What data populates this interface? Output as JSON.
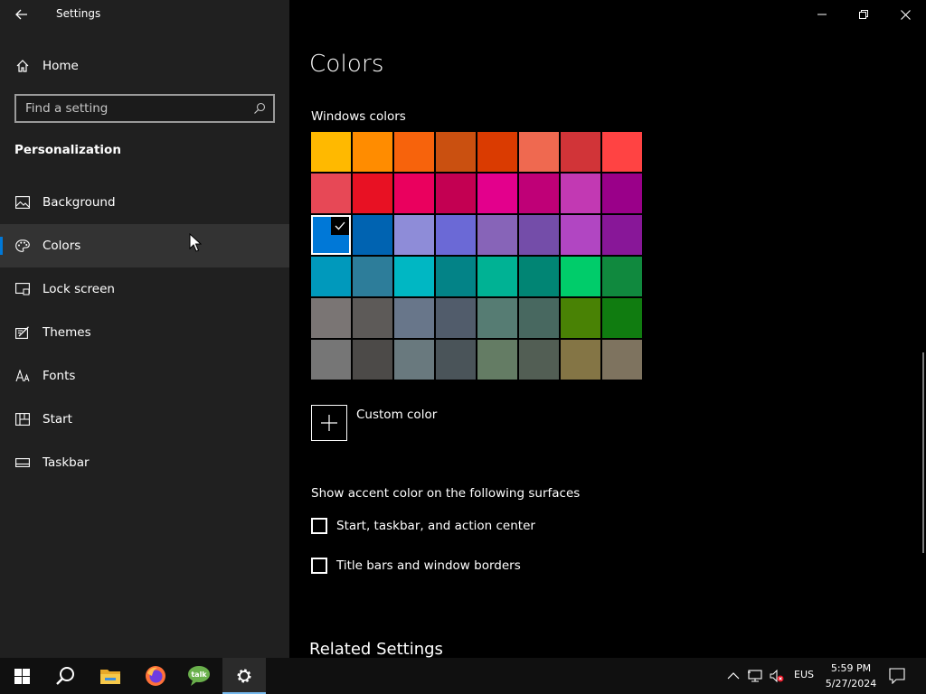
{
  "window": {
    "app_title": "Settings",
    "controls": [
      "minimize-icon",
      "restore-icon",
      "close-icon"
    ]
  },
  "sidebar": {
    "home_label": "Home",
    "search_placeholder": "Find a setting",
    "section_title": "Personalization",
    "items": [
      {
        "label": "Background",
        "icon": "picture-icon"
      },
      {
        "label": "Colors",
        "icon": "palette-icon",
        "selected": true
      },
      {
        "label": "Lock screen",
        "icon": "lock-screen-icon"
      },
      {
        "label": "Themes",
        "icon": "themes-icon"
      },
      {
        "label": "Fonts",
        "icon": "fonts-icon"
      },
      {
        "label": "Start",
        "icon": "start-layout-icon"
      },
      {
        "label": "Taskbar",
        "icon": "taskbar-icon"
      }
    ]
  },
  "main": {
    "title": "Colors",
    "windows_colors_label": "Windows colors",
    "swatches": [
      "#FFB900",
      "#FF8C00",
      "#F7630C",
      "#CA5010",
      "#DA3B01",
      "#EF6950",
      "#D13438",
      "#FF4343",
      "#E74856",
      "#E81123",
      "#EA005E",
      "#C30052",
      "#E3008C",
      "#BF0077",
      "#C239B3",
      "#9A0089",
      "#0078D7",
      "#0063B1",
      "#8E8CD8",
      "#6B69D6",
      "#8764B8",
      "#744DA9",
      "#B146C2",
      "#881798",
      "#0099BC",
      "#2D7D9A",
      "#00B7C3",
      "#038387",
      "#00B294",
      "#018574",
      "#00CC6A",
      "#10893E",
      "#7A7574",
      "#5D5A58",
      "#68768A",
      "#515C6B",
      "#567C73",
      "#486860",
      "#498205",
      "#107C10",
      "#767676",
      "#4C4A48",
      "#69797E",
      "#4A5459",
      "#647C64",
      "#525E54",
      "#847545",
      "#7E735F"
    ],
    "selected_swatch_index": 16,
    "custom_color_label": "Custom color",
    "accent_surfaces_label": "Show accent color on the following surfaces",
    "checkboxes": [
      {
        "label": "Start, taskbar, and action center",
        "checked": false
      },
      {
        "label": "Title bars and window borders",
        "checked": false
      }
    ],
    "related_heading": "Related Settings"
  },
  "taskbar": {
    "apps": [
      "start-icon",
      "search-icon",
      "file-explorer-icon",
      "firefox-icon",
      "talk-icon",
      "settings-gear-icon"
    ],
    "active_app": "settings-gear-icon",
    "tray": {
      "language": "EUS",
      "time": "5:59 PM",
      "date": "5/27/2024"
    }
  }
}
